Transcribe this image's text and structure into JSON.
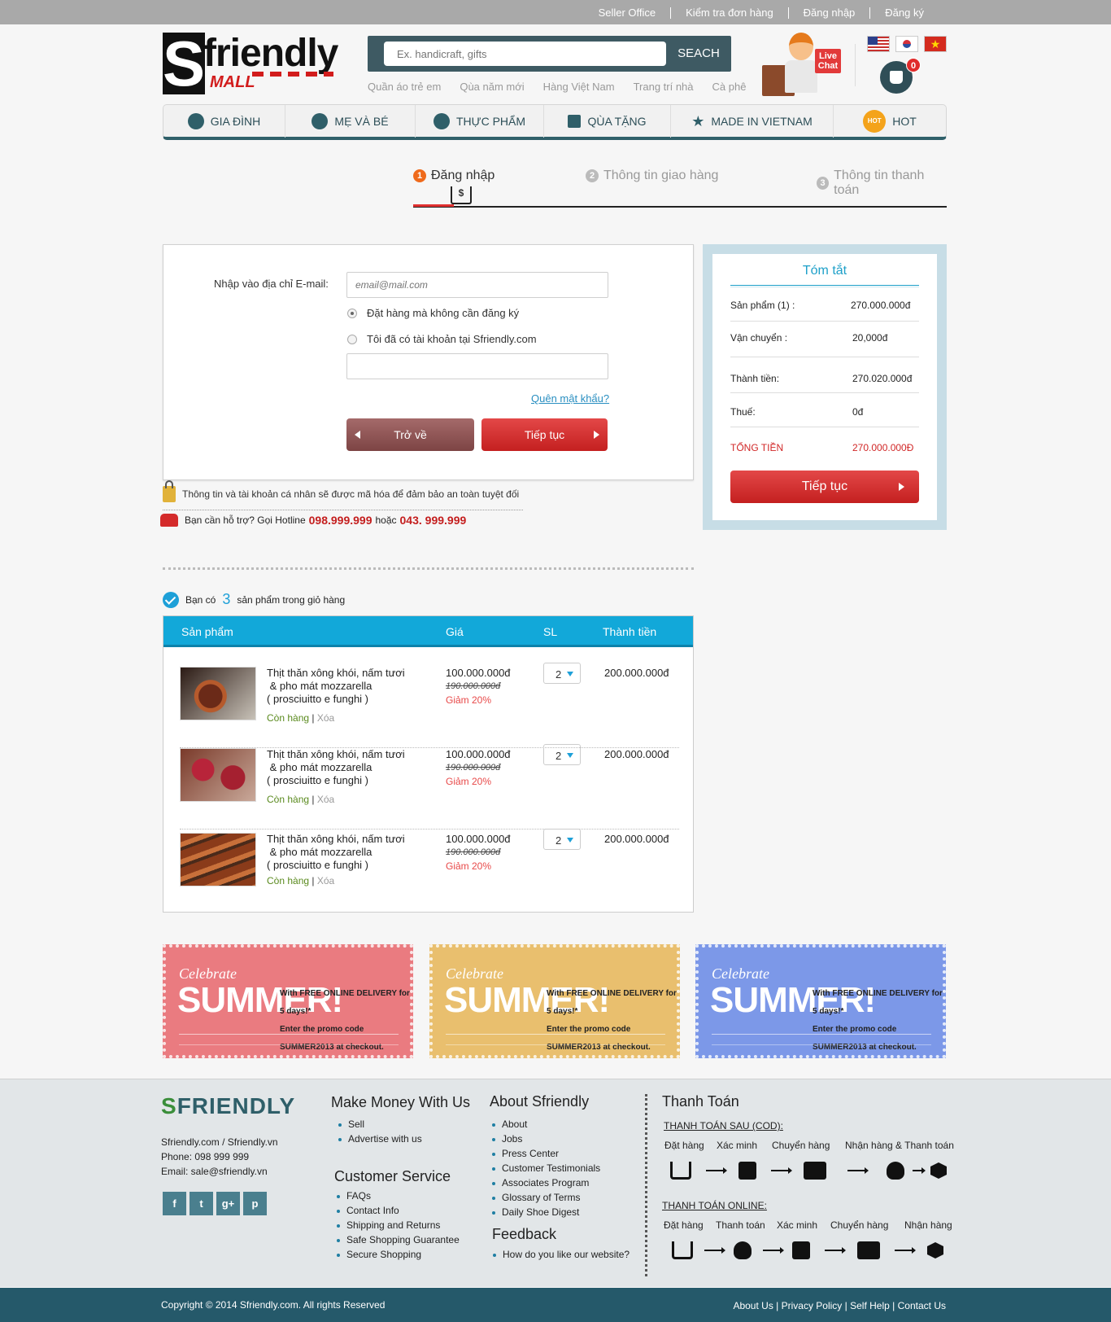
{
  "topbar": {
    "links": [
      "Seller  Office",
      "Kiểm tra đơn hàng",
      "Đăng nhập",
      "Đăng ký"
    ]
  },
  "logo": {
    "s": "S",
    "word": "friendly",
    "mall": "MALL"
  },
  "search": {
    "placeholder": "Ex. handicraft, gifts",
    "button": "SEACH"
  },
  "quick_links": [
    "Quần áo trẻ em",
    "Qùa năm mới",
    "Hàng Việt Nam",
    "Trang trí nhà",
    "Cà phê"
  ],
  "livechat": {
    "label_1": "Live",
    "label_2": "Chat"
  },
  "cart": {
    "count": "0"
  },
  "nav": [
    "GIA ĐÌNH",
    "MẸ VÀ BÉ",
    "THỰC PHẨM",
    "QÙA TẶNG",
    "MADE IN VIETNAM",
    "HOT"
  ],
  "nav_hot_badge": "HOT",
  "steps": [
    {
      "n": "1",
      "label": "Đăng nhập"
    },
    {
      "n": "2",
      "label": "Thông tin giao hàng"
    },
    {
      "n": "3",
      "label": "Thông tin thanh toán"
    }
  ],
  "step_cart_glyph": "$",
  "login": {
    "email_label": "Nhập vào địa chỉ E-mail:",
    "email_placeholder": "email@mail.com",
    "option_guest": "Đặt hàng mà không cần đăng ký",
    "option_member": "Tôi đã có tài khoản tại Sfriendly.com",
    "forgot": "Quên mật khẩu?",
    "back": "Trở về",
    "next": "Tiếp tục"
  },
  "secure_note": "Thông tin và tài khoản cá nhân sẽ được mã hóa để đảm bảo an toàn tuyệt đối",
  "hotline": {
    "text": "Bạn cần hỗ trợ? Gọi Hotline",
    "num1": "098.999.999",
    "or": "hoặc",
    "num2": "043. 999.999"
  },
  "summary": {
    "title": "Tóm tắt",
    "rows": [
      {
        "label": "Sản phẩm (1) :",
        "value": "270.000.000đ"
      },
      {
        "label": "Vận chuyển :",
        "value": "20,000đ"
      },
      {
        "label": "Thành tiền:",
        "value": "270.020.000đ"
      },
      {
        "label": "Thuế:",
        "value": "0đ"
      },
      {
        "label": "TỔNG TIỀN",
        "value": "270.000.000Đ"
      }
    ],
    "button": "Tiếp tục"
  },
  "cart_info": {
    "prefix": "Bạn có",
    "count": "3",
    "suffix": "sản phẩm trong giỏ hàng"
  },
  "table": {
    "headers": [
      "Sản phẩm",
      "Giá",
      "SL",
      "Thành tiền"
    ],
    "rows": [
      {
        "name_1": "Thịt thăn xông khói, nấm tươi",
        "name_2": " & pho mát mozzarella",
        "name_3": "( prosciuitto e funghi )",
        "stock": "Còn hàng",
        "sep": "|",
        "delete": "Xóa",
        "price": "100.000.000đ",
        "old": "190.000.000đ",
        "discount": "Giảm 20%",
        "qty": "2",
        "total": "200.000.000đ"
      },
      {
        "name_1": "Thịt thăn xông khói, nấm tươi",
        "name_2": " & pho mát mozzarella",
        "name_3": "( prosciuitto e funghi )",
        "stock": "Còn hàng",
        "sep": "|",
        "delete": "Xóa",
        "price": "100.000.000đ",
        "old": "190.000.000đ",
        "discount": "Giảm 20%",
        "qty": "2",
        "total": "200.000.000đ"
      },
      {
        "name_1": "Thịt thăn xông khói, nấm tươi",
        "name_2": " & pho mát mozzarella",
        "name_3": "( prosciuitto e funghi )",
        "stock": "Còn hàng",
        "sep": "|",
        "delete": "Xóa",
        "price": "100.000.000đ",
        "old": "190.000.000đ",
        "discount": "Giảm 20%",
        "qty": "2",
        "total": "200.000.000đ"
      }
    ]
  },
  "banners": [
    {
      "celebrate": "Celebrate",
      "summer": "SUMMER!",
      "line1": "With FREE ONLINE DELIVERY for 5 days!*",
      "line2": "Enter the promo code SUMMER2013 at checkout.",
      "color": "#ea7b80"
    },
    {
      "celebrate": "Celebrate",
      "summer": "SUMMER!",
      "line1": "With FREE ONLINE DELIVERY for 5 days!*",
      "line2": "Enter the promo code SUMMER2013 at checkout.",
      "color": "#e9bf6e"
    },
    {
      "celebrate": "Celebrate",
      "summer": "SUMMER!",
      "line1": "With FREE ONLINE DELIVERY for 5 days!*",
      "line2": "Enter the promo code SUMMER2013 at checkout.",
      "color": "#7c98e8"
    }
  ],
  "footer": {
    "logo_1": "S",
    "logo_2": "FRIENDLY",
    "site": "Sfriendly.com / Sfriendly.vn",
    "phone": "Phone: 098 999 999",
    "email": "Email: sale@sfriendly.vn",
    "social": [
      "f",
      "t",
      "g+",
      "p"
    ],
    "make_money": {
      "title": "Make Money With Us",
      "items": [
        "Sell",
        "Advertise with us"
      ]
    },
    "customer_service": {
      "title": "Customer Service",
      "items": [
        "FAQs",
        "Contact Info",
        "Shipping and Returns",
        "Safe Shopping Guarantee",
        "Secure Shopping"
      ]
    },
    "about": {
      "title": "About Sfriendly",
      "items": [
        "About",
        "Jobs",
        "Press Center",
        "Customer Testimonials",
        "Associates Program",
        "Glossary of Terms",
        "Daily Shoe Digest"
      ]
    },
    "feedback": {
      "title": "Feedback",
      "items": [
        "How do you like our website?"
      ]
    },
    "payment": {
      "title": "Thanh Toán",
      "cod_title": "THANH TOÁN SAU (COD):",
      "cod_steps": [
        "Đặt hàng",
        "Xác minh",
        "Chuyển hàng",
        "Nhận hàng & Thanh toán"
      ],
      "online_title": "THANH TOÁN ONLINE:",
      "online_steps": [
        "Đặt hàng",
        "Thanh toán",
        "Xác minh",
        "Chuyển hàng",
        "Nhận hàng"
      ]
    },
    "copyright": "Copyright © 2014 Sfriendly.com. All rights Reserved",
    "bottom_links": [
      "About Us",
      "Privacy Policy",
      "Self Help",
      "Contact Us"
    ],
    "bottom_sep": "|"
  },
  "colors": {
    "accent": "#12a8d9",
    "nav": "#2f5f69",
    "red": "#d12727",
    "footer_bar": "#25596a"
  }
}
